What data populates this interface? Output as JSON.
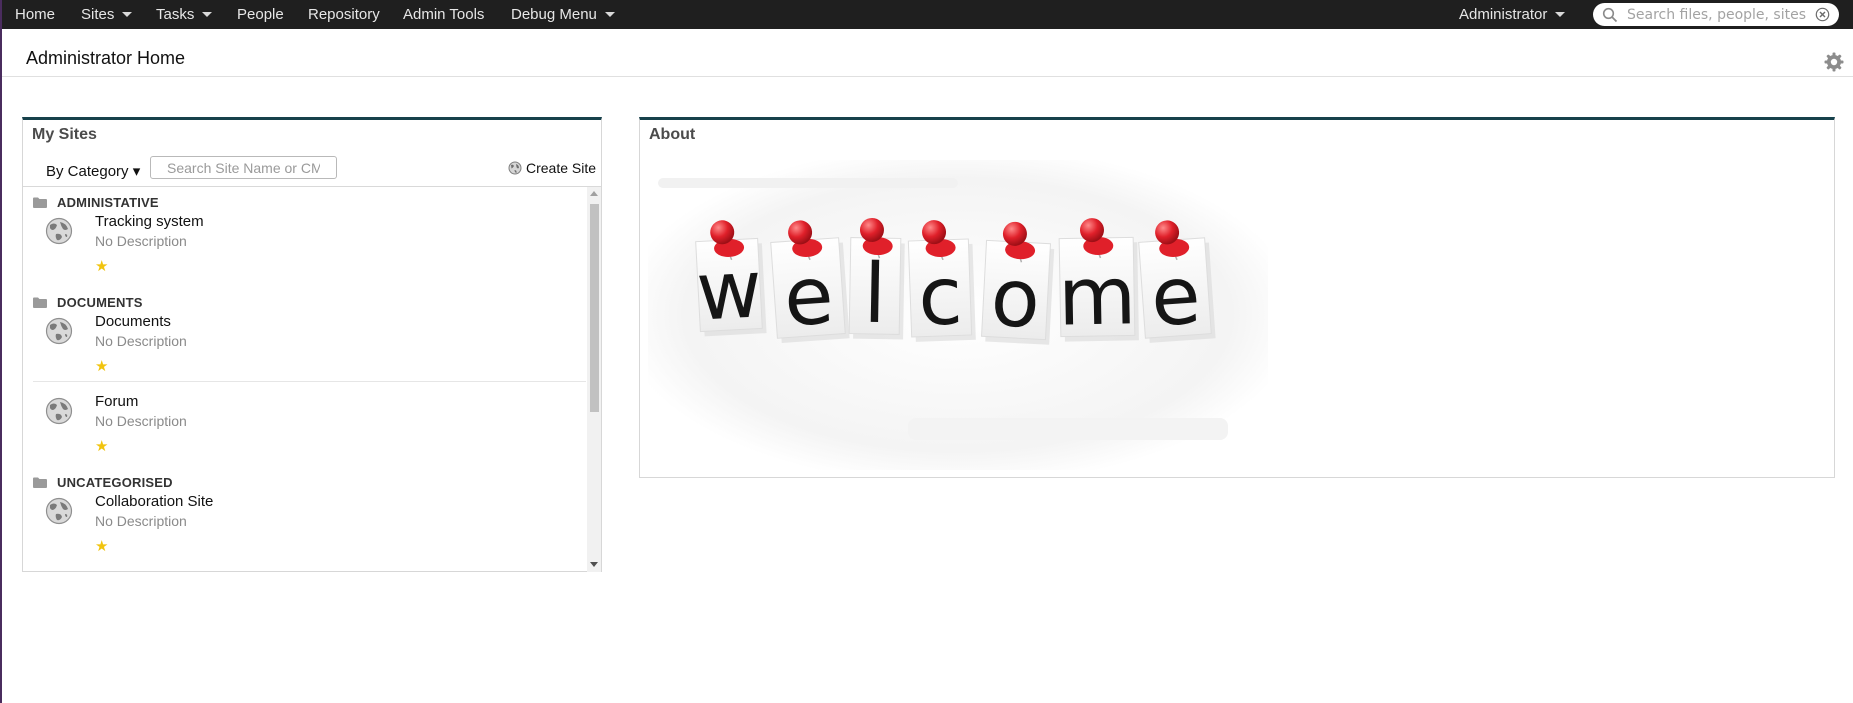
{
  "topbar": {
    "items": [
      {
        "label": "Home"
      },
      {
        "label": "Sites"
      },
      {
        "label": "Tasks"
      },
      {
        "label": "People"
      },
      {
        "label": "Repository"
      },
      {
        "label": "Admin Tools"
      },
      {
        "label": "Debug Menu"
      }
    ],
    "user_menu": "Administrator",
    "search_placeholder": "Search files, people, sites"
  },
  "page": {
    "title": "Administrator Home"
  },
  "my_sites": {
    "title": "My Sites",
    "filter_label": "By Category ▾",
    "search_placeholder": "Search Site Name or CM",
    "create_site_label": "Create Site",
    "categories": [
      {
        "name": "ADMINISTATIVE",
        "sites": [
          {
            "name": "Tracking system",
            "description": "No Description",
            "favorite": "★"
          }
        ]
      },
      {
        "name": "DOCUMENTS",
        "sites": [
          {
            "name": "Documents",
            "description": "No Description",
            "favorite": "★"
          },
          {
            "name": "Forum",
            "description": "No Description",
            "favorite": "★"
          }
        ]
      },
      {
        "name": "UNCATEGORISED",
        "sites": [
          {
            "name": "Collaboration Site",
            "description": "No Description",
            "favorite": "★"
          }
        ]
      }
    ]
  },
  "about": {
    "title": "About",
    "welcome_letters": [
      "w",
      "e",
      "l",
      "c",
      "o",
      "m",
      "e"
    ]
  },
  "colors": {
    "topbar_bg": "#1f1f1f",
    "dashlet_accent": "#17414b",
    "star": "#f1c40f",
    "pin_red": "#e0202a"
  },
  "icons": {
    "settings": "gear-icon",
    "search": "search-icon",
    "clear": "clear-icon",
    "site": "globe-icon",
    "category": "folder-icon"
  }
}
